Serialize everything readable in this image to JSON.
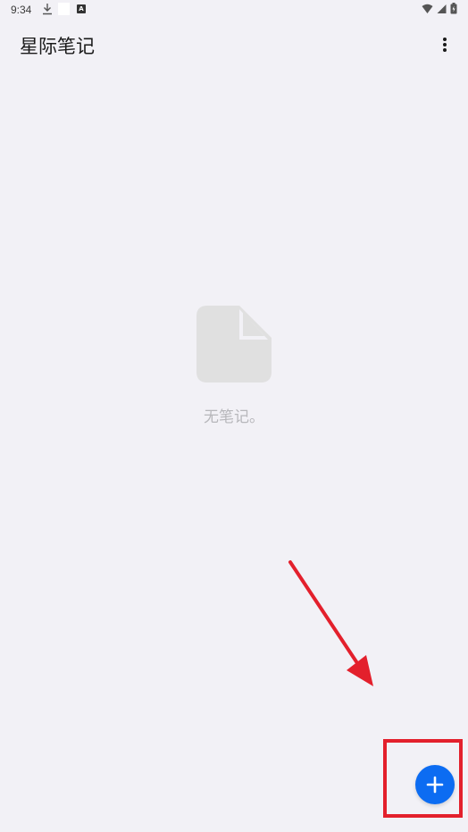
{
  "status_bar": {
    "time": "9:34",
    "app_icon_letter": "A",
    "icons": [
      "download-icon",
      "wifi-icon",
      "signal-icon",
      "battery-icon"
    ]
  },
  "app_bar": {
    "title": "星际笔记",
    "menu_icon": "more-vert-icon"
  },
  "empty_state": {
    "icon": "document-icon",
    "message": "无笔记。"
  },
  "fab": {
    "icon": "plus-icon"
  },
  "colors": {
    "background": "#f2f1f6",
    "accent": "#0c6cf2",
    "annotation": "#e3202c",
    "empty_text": "#b7b7bb",
    "empty_icon": "#e0e0e0"
  }
}
